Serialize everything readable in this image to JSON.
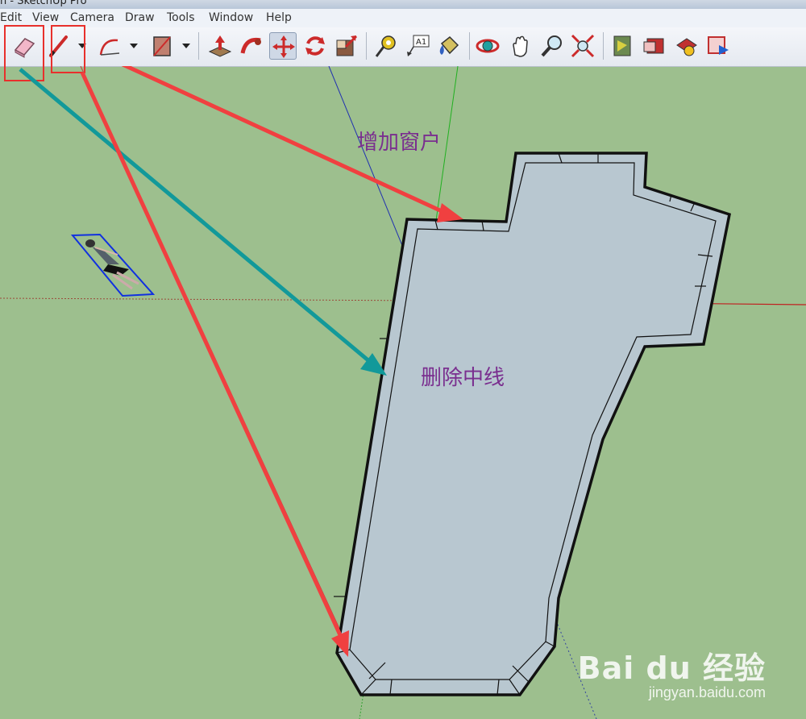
{
  "window": {
    "title": "n - SketchUp Pro"
  },
  "menubar": {
    "items": [
      "Edit",
      "View",
      "Camera",
      "Draw",
      "Tools",
      "Window",
      "Help"
    ]
  },
  "toolbar": {
    "tools": [
      "eraser-tool",
      "pencil-tool",
      "arc-tool",
      "rectangle-tool",
      "push-pull-tool",
      "follow-me-tool",
      "move-tool",
      "rotate-tool",
      "scale-tool",
      "tape-measure-tool",
      "text-tool",
      "paint-bucket-tool",
      "orbit-tool",
      "pan-tool",
      "zoom-tool",
      "zoom-extents-tool",
      "previous-view-tool",
      "next-view-tool",
      "get-models-tool",
      "share-model-tool"
    ],
    "active_tool": "move-tool",
    "highlighted": [
      "eraser-tool",
      "pencil-tool"
    ]
  },
  "annotations": {
    "add_window": "增加窗户",
    "delete_centerline": "删除中线"
  },
  "watermark": {
    "logo": "Bai du 经验",
    "url": "jingyan.baidu.com"
  },
  "colors": {
    "annotation_text": "#7a2f8f",
    "red_arrow": "#f04040",
    "teal_arrow": "#12999a",
    "floor_fill": "#b8c7d0",
    "ground": "#9dbf8e",
    "highlight_box": "#e8302c"
  }
}
